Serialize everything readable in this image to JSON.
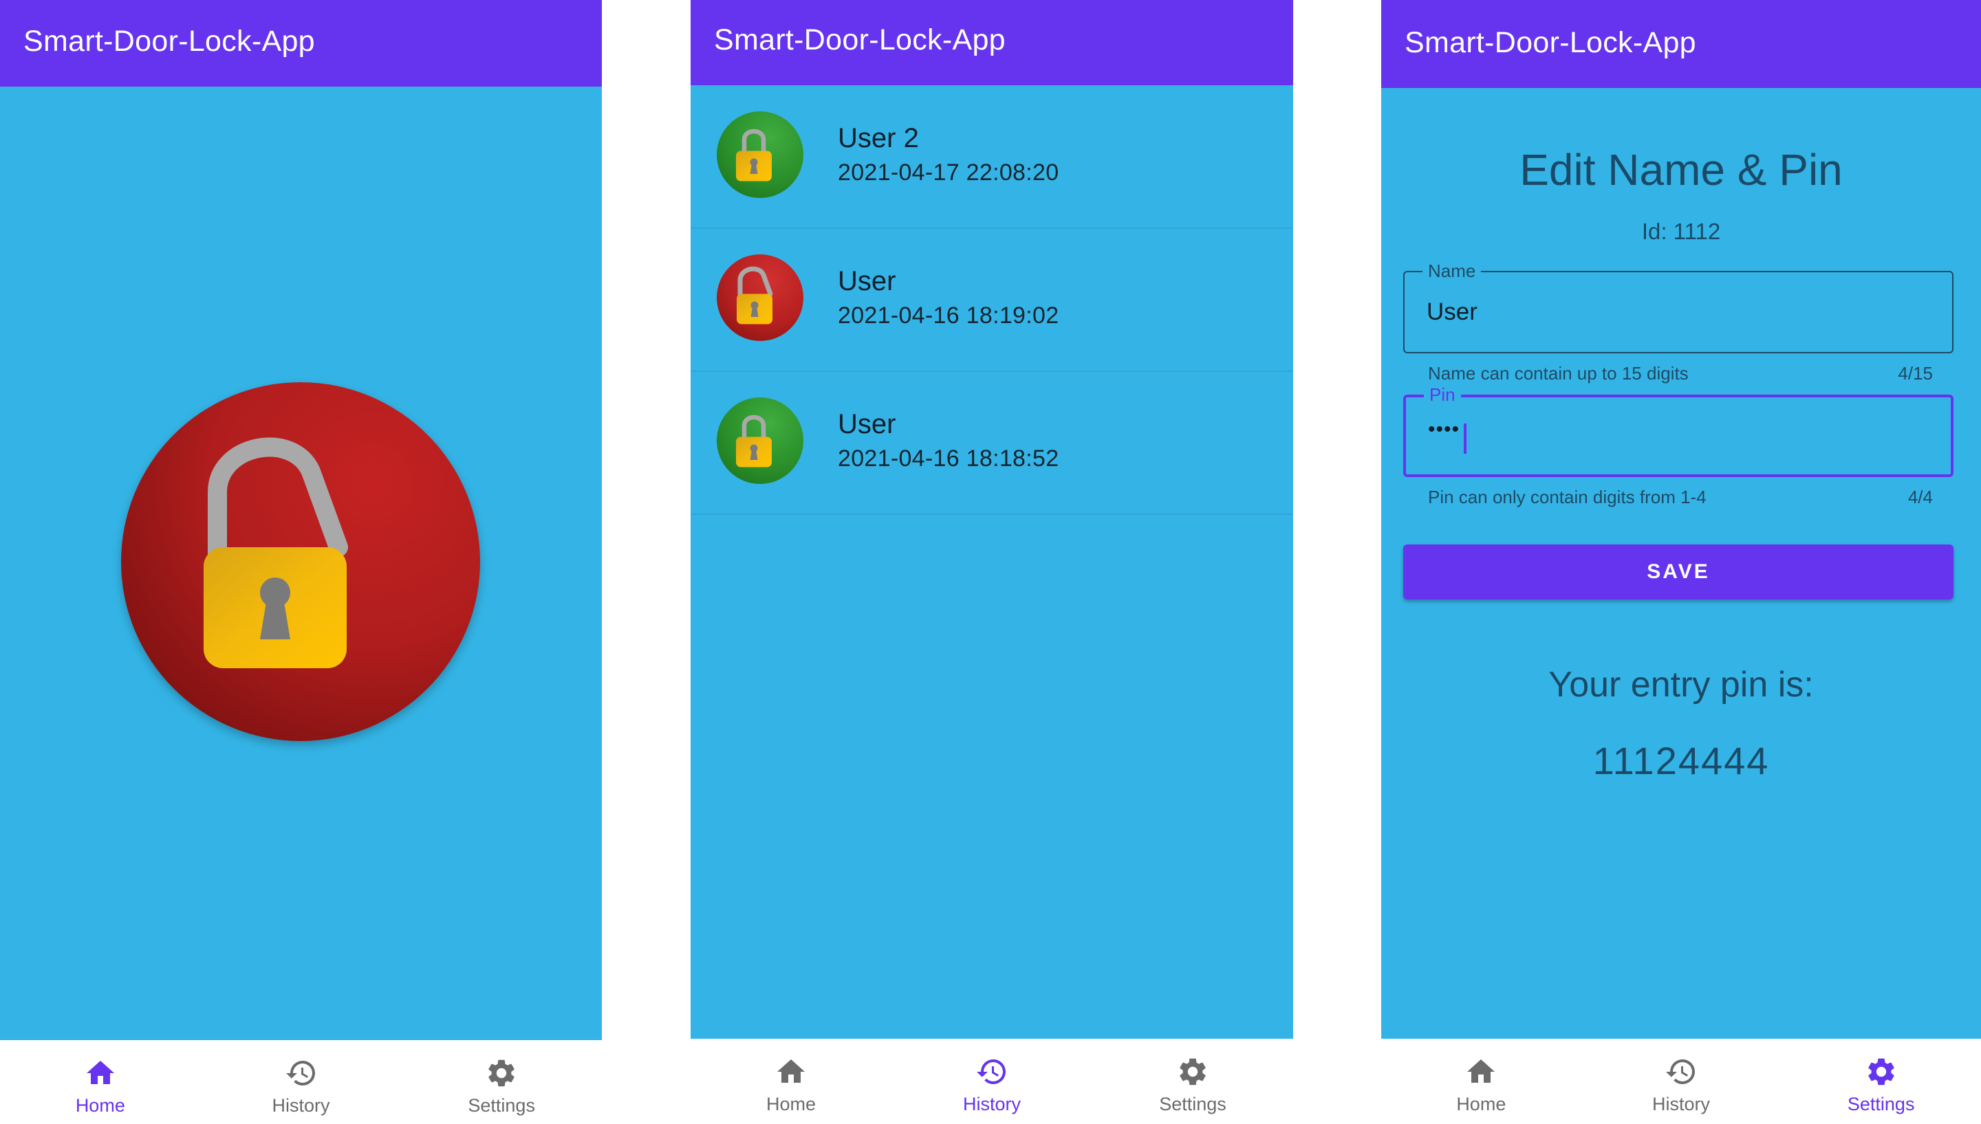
{
  "app_title": "Smart-Door-Lock-App",
  "colors": {
    "primary": "#6633ee",
    "background": "#34b4e6",
    "locked_green": "#2a8f2a",
    "unlocked_red": "#b41f1f",
    "lock_body": "#f2b90f"
  },
  "nav": {
    "home": "Home",
    "history": "History",
    "settings": "Settings"
  },
  "home": {
    "lock_state": "unlocked",
    "lock_icon": "unlocked-padlock-icon"
  },
  "history": {
    "items": [
      {
        "name": "User 2",
        "timestamp": "2021-04-17 22:08:20",
        "state": "locked"
      },
      {
        "name": "User",
        "timestamp": "2021-04-16 18:19:02",
        "state": "unlocked"
      },
      {
        "name": "User",
        "timestamp": "2021-04-16 18:18:52",
        "state": "locked"
      }
    ]
  },
  "settings": {
    "title": "Edit Name & Pin",
    "id_label": "Id: 1112",
    "name_field": {
      "label": "Name",
      "value": "User",
      "helper": "Name can contain up to 15 digits",
      "counter": "4/15"
    },
    "pin_field": {
      "label": "Pin",
      "value": "••••",
      "helper": "Pin can only contain digits from 1-4",
      "counter": "4/4"
    },
    "save_label": "SAVE",
    "entry_label": "Your entry pin is:",
    "entry_pin": "11124444"
  }
}
